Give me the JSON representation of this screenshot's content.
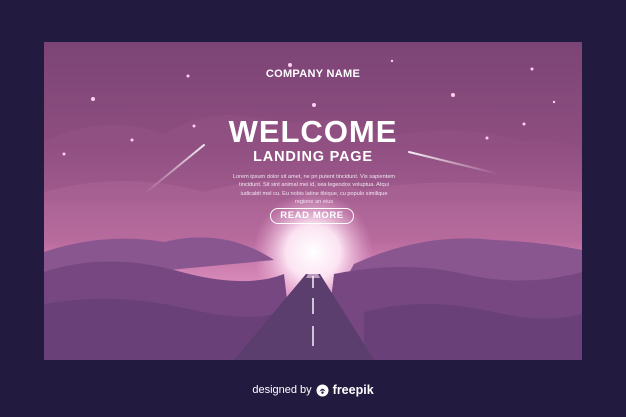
{
  "hero": {
    "company_name": "COMPANY NAME",
    "title": "WELCOME",
    "subtitle": "LANDING PAGE",
    "body_lines": [
      "Lorem ipsum dolor sit amet, ne pri putent tincidunt. Vis sapientem",
      "tincidunt. Sit sint animal mei id, sea legendos voluptua. Atqui",
      "iudicabit mel cu. Eu nobis latine tibique, cu populo similique",
      "regione an eius"
    ],
    "button_label": "READ MORE"
  },
  "footer": {
    "designed_by": "designed by",
    "brand": "freepik"
  },
  "colors": {
    "outer_background": "#231a3f",
    "sky_top": "#8a4a79",
    "sky_bottom": "#d98ab8",
    "hills": "#7d4a82",
    "road": "#5a3b6c"
  },
  "icons": {
    "brand_icon": "freepik-logo-icon"
  }
}
